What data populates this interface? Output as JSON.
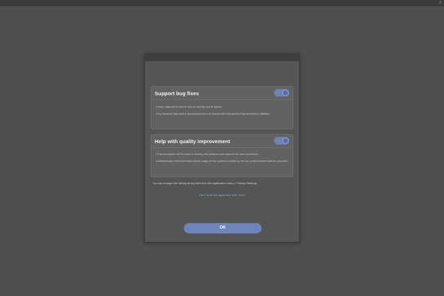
{
  "window": {
    "close_glyph": "×"
  },
  "dialog": {
    "cards": [
      {
        "title": "Support bug fixes",
        "enabled": true,
        "bullets": [
          "• Crash data will be sent to help us identify and fix issues.",
          "• Any personal data sent is anonymized and not shared with third parties beyond Adobe's affiliates."
        ]
      },
      {
        "title": "Help with quality improvement",
        "enabled": true,
        "bullets": [
          "• This information will be used to develop new features and improve the user experience.",
          "• Automatically send information about usage on this system to Adobe so we can protect Adobe features and data."
        ]
      }
    ],
    "note": "You can change this setting at any time from the application menu > Privacy Settings.",
    "link": "Don't show this again and learn more",
    "ok_label": "OK"
  },
  "colors": {
    "background": "#4f4f4f",
    "dialog": "#555555",
    "card": "#626262",
    "accent": "#6f84b8",
    "link": "#8fb0e8"
  }
}
